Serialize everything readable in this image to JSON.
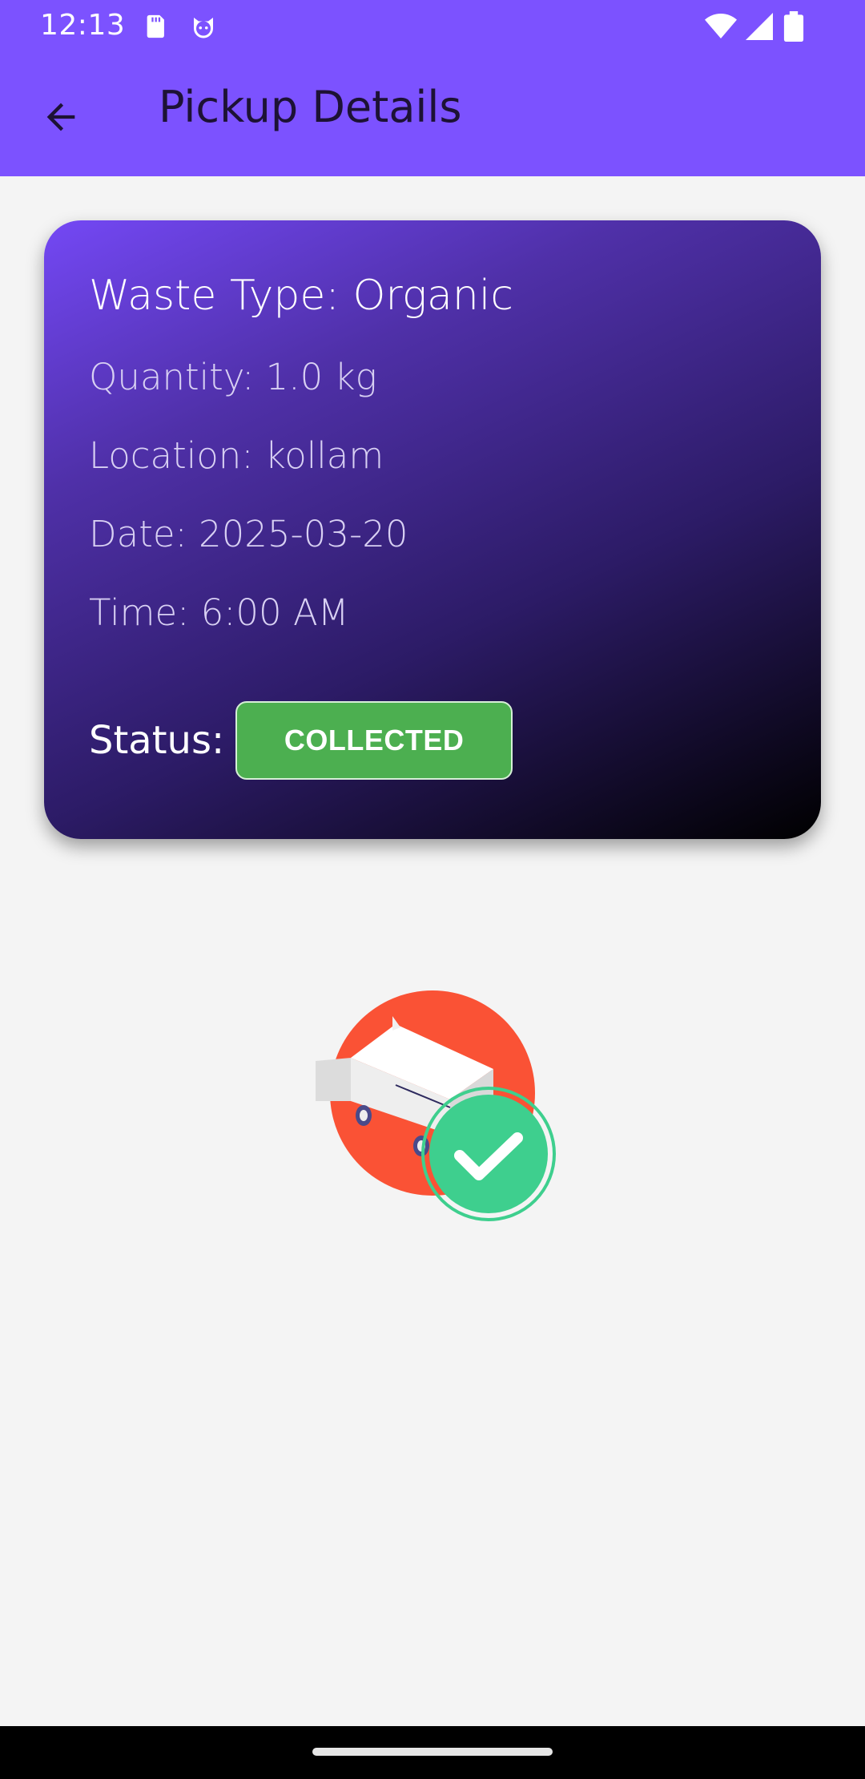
{
  "status_bar": {
    "time": "12:13",
    "left_icons": [
      "sd-card-icon",
      "cat-face-icon"
    ],
    "right_icons": [
      "wifi-icon",
      "cell-signal-icon",
      "battery-icon"
    ]
  },
  "app_bar": {
    "title": "Pickup Details",
    "back_icon": "arrow-back-icon"
  },
  "card": {
    "waste_type": "Waste Type: Organic",
    "quantity": "Quantity: 1.0 kg",
    "location": "Location: kollam",
    "date": "Date: 2025-03-20",
    "time": "Time: 6:00 AM",
    "status_label": "Status:",
    "status_value": "COLLECTED"
  },
  "colors": {
    "primary": "#7c52ff",
    "status_green": "#4caf50",
    "check_green": "#3ecf8e",
    "illustration_red": "#fa5235"
  },
  "illustration": {
    "icon": "truck-collected-check-icon"
  }
}
